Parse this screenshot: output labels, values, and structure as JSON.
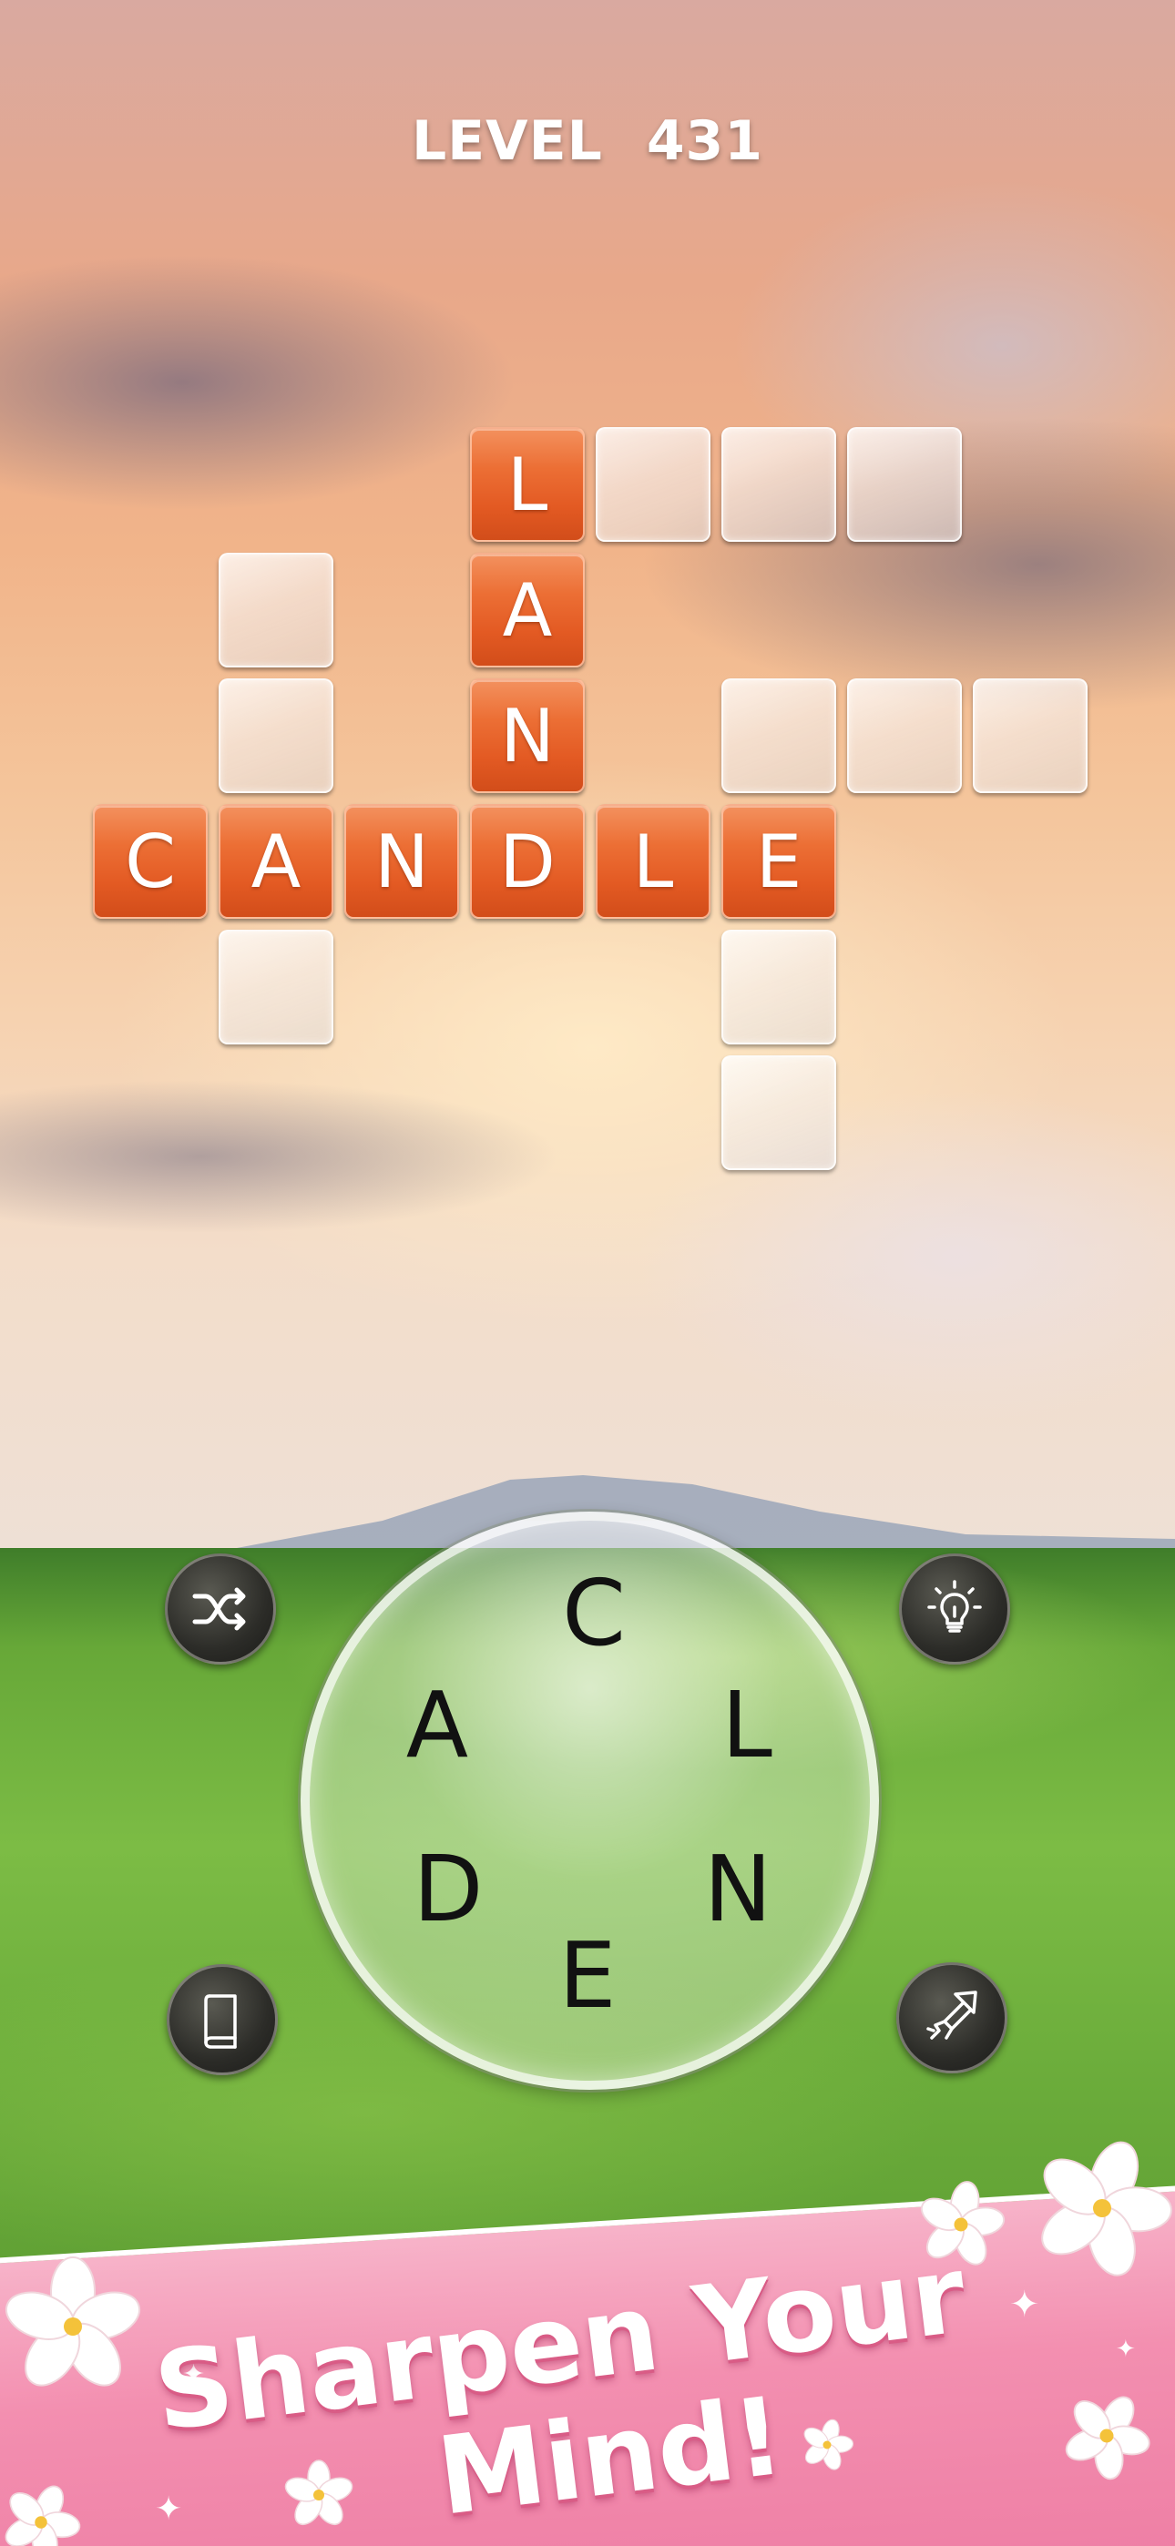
{
  "level": {
    "label": "LEVEL",
    "number": "431"
  },
  "grid": {
    "tiles": [
      {
        "row": 0,
        "col": 3,
        "letter": "L"
      },
      {
        "row": 0,
        "col": 4,
        "letter": ""
      },
      {
        "row": 0,
        "col": 5,
        "letter": ""
      },
      {
        "row": 0,
        "col": 6,
        "letter": ""
      },
      {
        "row": 1,
        "col": 1,
        "letter": ""
      },
      {
        "row": 1,
        "col": 3,
        "letter": "A"
      },
      {
        "row": 2,
        "col": 1,
        "letter": ""
      },
      {
        "row": 2,
        "col": 3,
        "letter": "N"
      },
      {
        "row": 2,
        "col": 5,
        "letter": ""
      },
      {
        "row": 2,
        "col": 6,
        "letter": ""
      },
      {
        "row": 2,
        "col": 7,
        "letter": ""
      },
      {
        "row": 3,
        "col": 0,
        "letter": "C"
      },
      {
        "row": 3,
        "col": 1,
        "letter": "A"
      },
      {
        "row": 3,
        "col": 2,
        "letter": "N"
      },
      {
        "row": 3,
        "col": 3,
        "letter": "D"
      },
      {
        "row": 3,
        "col": 4,
        "letter": "L"
      },
      {
        "row": 3,
        "col": 5,
        "letter": "E"
      },
      {
        "row": 4,
        "col": 1,
        "letter": ""
      },
      {
        "row": 4,
        "col": 5,
        "letter": ""
      },
      {
        "row": 5,
        "col": 5,
        "letter": ""
      }
    ]
  },
  "wheel": {
    "letters": [
      "C",
      "L",
      "N",
      "E",
      "D",
      "A"
    ]
  },
  "buttons": {
    "shuffle": "shuffle-icon",
    "hint": "lightbulb-icon",
    "dictionary": "book-icon",
    "finger_hint": "firework-icon"
  },
  "banner": {
    "line1": "Sharpen Your",
    "line2": "Mind!"
  },
  "colors": {
    "filled_tile": "#e8602a",
    "banner_pink": "#f38fb0"
  }
}
